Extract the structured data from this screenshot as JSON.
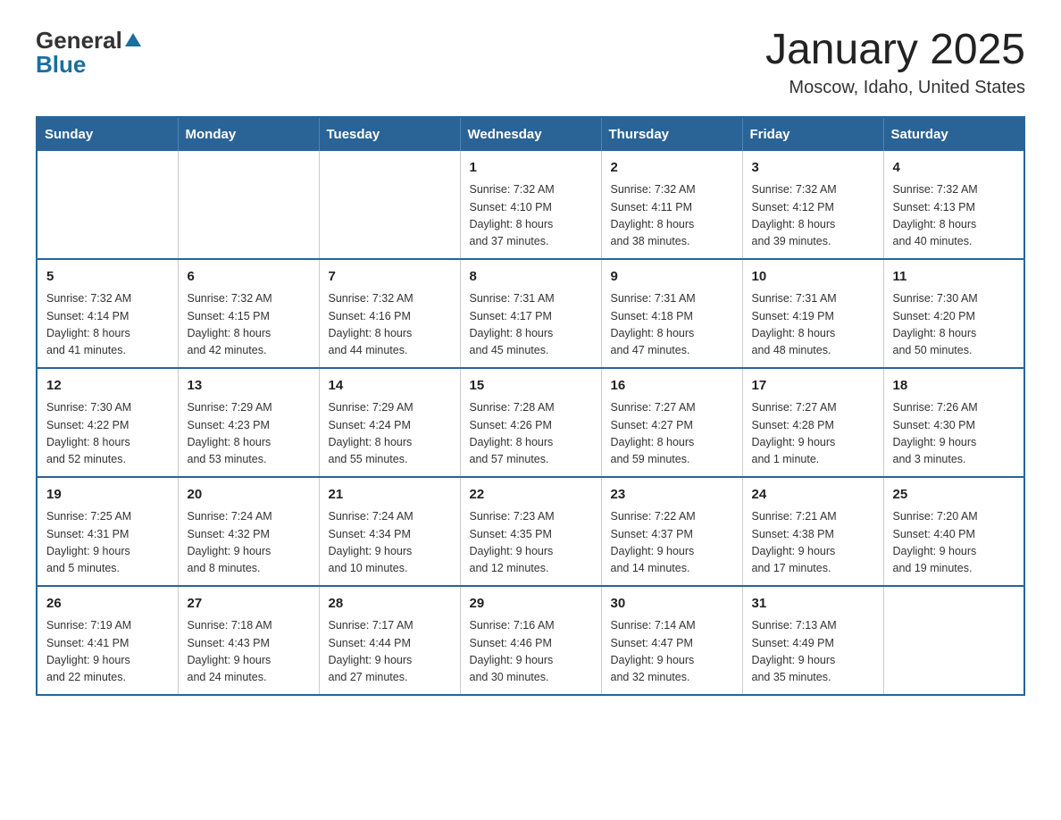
{
  "header": {
    "logo_general": "General",
    "logo_blue": "Blue",
    "month_title": "January 2025",
    "location": "Moscow, Idaho, United States"
  },
  "days_of_week": [
    "Sunday",
    "Monday",
    "Tuesday",
    "Wednesday",
    "Thursday",
    "Friday",
    "Saturday"
  ],
  "weeks": [
    [
      {
        "day": "",
        "info": ""
      },
      {
        "day": "",
        "info": ""
      },
      {
        "day": "",
        "info": ""
      },
      {
        "day": "1",
        "info": "Sunrise: 7:32 AM\nSunset: 4:10 PM\nDaylight: 8 hours\nand 37 minutes."
      },
      {
        "day": "2",
        "info": "Sunrise: 7:32 AM\nSunset: 4:11 PM\nDaylight: 8 hours\nand 38 minutes."
      },
      {
        "day": "3",
        "info": "Sunrise: 7:32 AM\nSunset: 4:12 PM\nDaylight: 8 hours\nand 39 minutes."
      },
      {
        "day": "4",
        "info": "Sunrise: 7:32 AM\nSunset: 4:13 PM\nDaylight: 8 hours\nand 40 minutes."
      }
    ],
    [
      {
        "day": "5",
        "info": "Sunrise: 7:32 AM\nSunset: 4:14 PM\nDaylight: 8 hours\nand 41 minutes."
      },
      {
        "day": "6",
        "info": "Sunrise: 7:32 AM\nSunset: 4:15 PM\nDaylight: 8 hours\nand 42 minutes."
      },
      {
        "day": "7",
        "info": "Sunrise: 7:32 AM\nSunset: 4:16 PM\nDaylight: 8 hours\nand 44 minutes."
      },
      {
        "day": "8",
        "info": "Sunrise: 7:31 AM\nSunset: 4:17 PM\nDaylight: 8 hours\nand 45 minutes."
      },
      {
        "day": "9",
        "info": "Sunrise: 7:31 AM\nSunset: 4:18 PM\nDaylight: 8 hours\nand 47 minutes."
      },
      {
        "day": "10",
        "info": "Sunrise: 7:31 AM\nSunset: 4:19 PM\nDaylight: 8 hours\nand 48 minutes."
      },
      {
        "day": "11",
        "info": "Sunrise: 7:30 AM\nSunset: 4:20 PM\nDaylight: 8 hours\nand 50 minutes."
      }
    ],
    [
      {
        "day": "12",
        "info": "Sunrise: 7:30 AM\nSunset: 4:22 PM\nDaylight: 8 hours\nand 52 minutes."
      },
      {
        "day": "13",
        "info": "Sunrise: 7:29 AM\nSunset: 4:23 PM\nDaylight: 8 hours\nand 53 minutes."
      },
      {
        "day": "14",
        "info": "Sunrise: 7:29 AM\nSunset: 4:24 PM\nDaylight: 8 hours\nand 55 minutes."
      },
      {
        "day": "15",
        "info": "Sunrise: 7:28 AM\nSunset: 4:26 PM\nDaylight: 8 hours\nand 57 minutes."
      },
      {
        "day": "16",
        "info": "Sunrise: 7:27 AM\nSunset: 4:27 PM\nDaylight: 8 hours\nand 59 minutes."
      },
      {
        "day": "17",
        "info": "Sunrise: 7:27 AM\nSunset: 4:28 PM\nDaylight: 9 hours\nand 1 minute."
      },
      {
        "day": "18",
        "info": "Sunrise: 7:26 AM\nSunset: 4:30 PM\nDaylight: 9 hours\nand 3 minutes."
      }
    ],
    [
      {
        "day": "19",
        "info": "Sunrise: 7:25 AM\nSunset: 4:31 PM\nDaylight: 9 hours\nand 5 minutes."
      },
      {
        "day": "20",
        "info": "Sunrise: 7:24 AM\nSunset: 4:32 PM\nDaylight: 9 hours\nand 8 minutes."
      },
      {
        "day": "21",
        "info": "Sunrise: 7:24 AM\nSunset: 4:34 PM\nDaylight: 9 hours\nand 10 minutes."
      },
      {
        "day": "22",
        "info": "Sunrise: 7:23 AM\nSunset: 4:35 PM\nDaylight: 9 hours\nand 12 minutes."
      },
      {
        "day": "23",
        "info": "Sunrise: 7:22 AM\nSunset: 4:37 PM\nDaylight: 9 hours\nand 14 minutes."
      },
      {
        "day": "24",
        "info": "Sunrise: 7:21 AM\nSunset: 4:38 PM\nDaylight: 9 hours\nand 17 minutes."
      },
      {
        "day": "25",
        "info": "Sunrise: 7:20 AM\nSunset: 4:40 PM\nDaylight: 9 hours\nand 19 minutes."
      }
    ],
    [
      {
        "day": "26",
        "info": "Sunrise: 7:19 AM\nSunset: 4:41 PM\nDaylight: 9 hours\nand 22 minutes."
      },
      {
        "day": "27",
        "info": "Sunrise: 7:18 AM\nSunset: 4:43 PM\nDaylight: 9 hours\nand 24 minutes."
      },
      {
        "day": "28",
        "info": "Sunrise: 7:17 AM\nSunset: 4:44 PM\nDaylight: 9 hours\nand 27 minutes."
      },
      {
        "day": "29",
        "info": "Sunrise: 7:16 AM\nSunset: 4:46 PM\nDaylight: 9 hours\nand 30 minutes."
      },
      {
        "day": "30",
        "info": "Sunrise: 7:14 AM\nSunset: 4:47 PM\nDaylight: 9 hours\nand 32 minutes."
      },
      {
        "day": "31",
        "info": "Sunrise: 7:13 AM\nSunset: 4:49 PM\nDaylight: 9 hours\nand 35 minutes."
      },
      {
        "day": "",
        "info": ""
      }
    ]
  ]
}
